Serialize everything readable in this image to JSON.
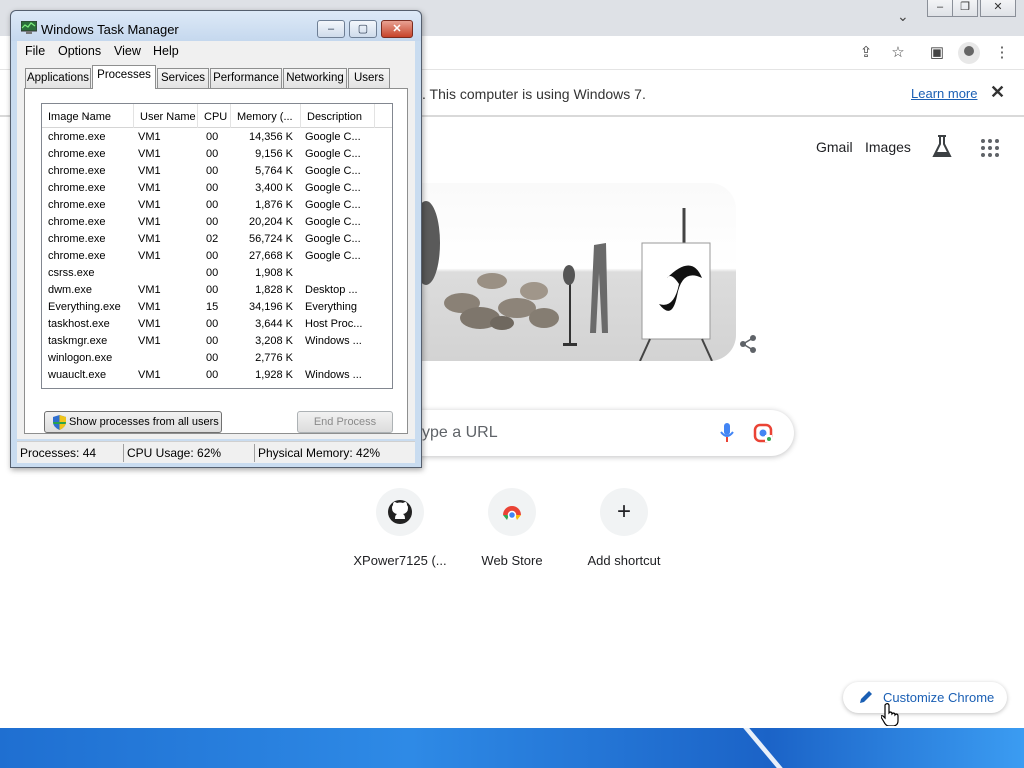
{
  "chrome": {
    "infobar_text": ". This computer is using Windows 7.",
    "learn_more": "Learn more",
    "close_glyph": "✕",
    "gmail": "Gmail",
    "images": "Images",
    "search_placeholder": "ype a URL",
    "shortcuts": [
      {
        "label": "XPower7125 (..."
      },
      {
        "label": "Web Store"
      },
      {
        "label": "Add shortcut",
        "glyph": "+"
      }
    ],
    "customize_label": "Customize Chrome",
    "accent_color": "#1a5fb4"
  },
  "taskmanager": {
    "title": "Windows Task Manager",
    "menu": [
      "File",
      "Options",
      "View",
      "Help"
    ],
    "tabs": [
      "Applications",
      "Processes",
      "Services",
      "Performance",
      "Networking",
      "Users"
    ],
    "active_tab": "Processes",
    "columns": [
      "Image Name",
      "User Name",
      "CPU",
      "Memory (...",
      "Description"
    ],
    "processes": [
      {
        "name": "chrome.exe",
        "user": "VM1",
        "cpu": "00",
        "mem": "14,356 K",
        "desc": "Google C..."
      },
      {
        "name": "chrome.exe",
        "user": "VM1",
        "cpu": "00",
        "mem": "9,156 K",
        "desc": "Google C..."
      },
      {
        "name": "chrome.exe",
        "user": "VM1",
        "cpu": "00",
        "mem": "5,764 K",
        "desc": "Google C..."
      },
      {
        "name": "chrome.exe",
        "user": "VM1",
        "cpu": "00",
        "mem": "3,400 K",
        "desc": "Google C..."
      },
      {
        "name": "chrome.exe",
        "user": "VM1",
        "cpu": "00",
        "mem": "1,876 K",
        "desc": "Google C..."
      },
      {
        "name": "chrome.exe",
        "user": "VM1",
        "cpu": "00",
        "mem": "20,204 K",
        "desc": "Google C..."
      },
      {
        "name": "chrome.exe",
        "user": "VM1",
        "cpu": "02",
        "mem": "56,724 K",
        "desc": "Google C..."
      },
      {
        "name": "chrome.exe",
        "user": "VM1",
        "cpu": "00",
        "mem": "27,668 K",
        "desc": "Google C..."
      },
      {
        "name": "csrss.exe",
        "user": "",
        "cpu": "00",
        "mem": "1,908 K",
        "desc": ""
      },
      {
        "name": "dwm.exe",
        "user": "VM1",
        "cpu": "00",
        "mem": "1,828 K",
        "desc": "Desktop ..."
      },
      {
        "name": "Everything.exe",
        "user": "VM1",
        "cpu": "15",
        "mem": "34,196 K",
        "desc": "Everything"
      },
      {
        "name": "taskhost.exe",
        "user": "VM1",
        "cpu": "00",
        "mem": "3,644 K",
        "desc": "Host Proc..."
      },
      {
        "name": "taskmgr.exe",
        "user": "VM1",
        "cpu": "00",
        "mem": "3,208 K",
        "desc": "Windows ..."
      },
      {
        "name": "winlogon.exe",
        "user": "",
        "cpu": "00",
        "mem": "2,776 K",
        "desc": ""
      },
      {
        "name": "wuauclt.exe",
        "user": "VM1",
        "cpu": "00",
        "mem": "1,928 K",
        "desc": "Windows ..."
      }
    ],
    "show_all_button": "Show processes from all users",
    "end_process_button": "End Process",
    "status": {
      "processes": "Processes: 44",
      "cpu": "CPU Usage: 62%",
      "memory": "Physical Memory: 42%"
    }
  }
}
